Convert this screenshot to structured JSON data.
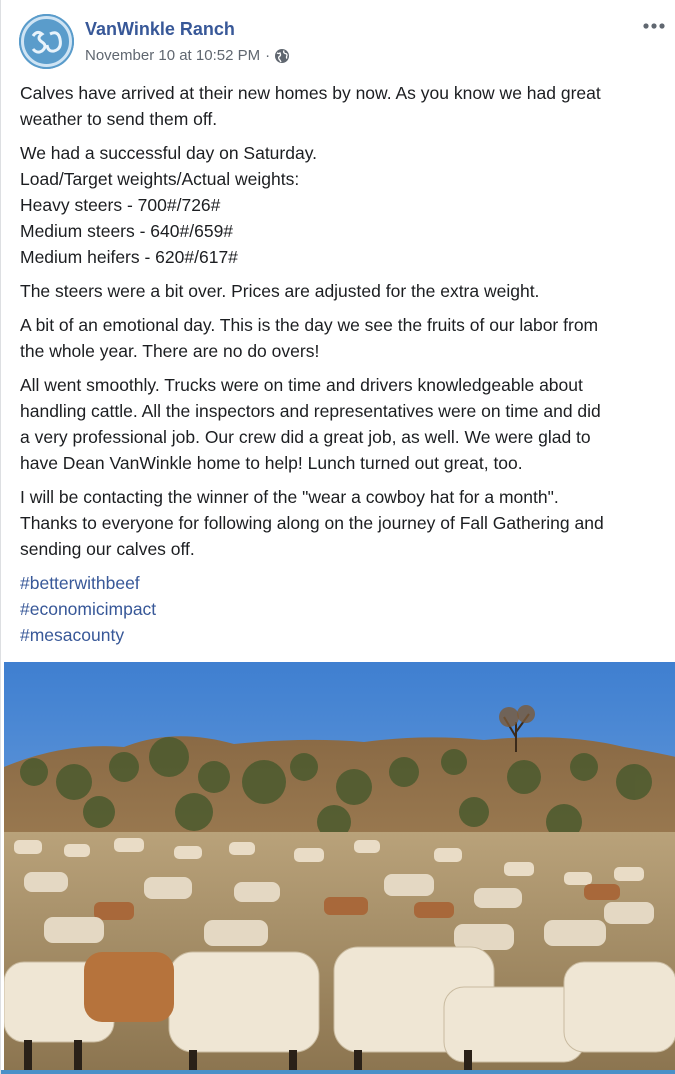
{
  "post": {
    "page_name": "VanWinkle Ranch",
    "timestamp": "November 10 at 10:52 PM",
    "separator": "·",
    "privacy_icon": "globe-icon",
    "more_icon": "more-options-icon",
    "more_glyph": "•••",
    "paragraphs": [
      [
        "Calves have arrived at their new homes by now. As you know we had great",
        "weather to send them off."
      ],
      [
        "We had a successful day on Saturday.",
        "Load/Target weights/Actual weights:",
        "Heavy steers - 700#/726#",
        "Medium steers - 640#/659#",
        "Medium heifers - 620#/617#"
      ],
      [
        "The steers were a bit over. Prices are adjusted for the extra weight."
      ],
      [
        "A bit of an emotional day. This is the day we see the fruits of our labor from",
        "the whole year. There are no do overs!"
      ],
      [
        "All went smoothly. Trucks were on time and drivers knowledgeable about",
        "handling cattle. All the inspectors and representatives were on time and did",
        "a very professional job. Our crew did a great job, as well. We were glad to",
        "have Dean VanWinkle home to help! Lunch turned out great, too."
      ],
      [
        "I will be contacting the winner of the \"wear a cowboy hat for a month\".",
        "Thanks to everyone for following along on the journey of Fall Gathering and",
        "sending our calves off."
      ]
    ],
    "hashtags": [
      "#betterwithbeef",
      "#economicimpact",
      "#mesacounty"
    ],
    "photo_description_icon": "cattle-herd-photo"
  },
  "colors": {
    "link": "#385898",
    "text": "#1c1e21",
    "meta": "#606770",
    "sky": "#4f8fd8"
  }
}
